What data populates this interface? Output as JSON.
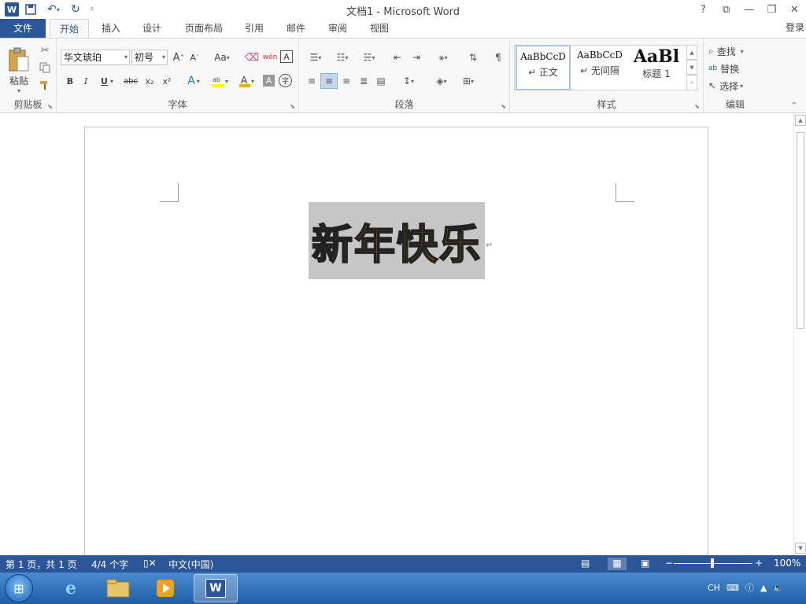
{
  "app": {
    "title": "文档1 - Microsoft Word",
    "login_label": "登录"
  },
  "window_controls": {
    "help": "?",
    "ribbon_opts": "⧉",
    "minimize": "—",
    "restore": "❐",
    "close": "✕"
  },
  "tabs": [
    {
      "label": "文件"
    },
    {
      "label": "开始"
    },
    {
      "label": "插入"
    },
    {
      "label": "设计"
    },
    {
      "label": "页面布局"
    },
    {
      "label": "引用"
    },
    {
      "label": "邮件"
    },
    {
      "label": "审阅"
    },
    {
      "label": "视图"
    }
  ],
  "ribbon": {
    "clipboard": {
      "label": "剪贴板",
      "paste": "粘贴"
    },
    "font": {
      "label": "字体",
      "font_name": "华文琥珀",
      "font_size": "初号",
      "bold": "B",
      "italic": "I",
      "underline": "U",
      "strike": "abc",
      "sub": "x₂",
      "sup": "x²",
      "case": "Aa",
      "grow": "A",
      "shrink": "A",
      "pinyin": "wén",
      "border": "A"
    },
    "paragraph": {
      "label": "段落"
    },
    "styles": {
      "label": "样式",
      "items": [
        {
          "sample": "AaBbCcD",
          "name": "↵ 正文"
        },
        {
          "sample": "AaBbCcD",
          "name": "↵ 无间隔"
        },
        {
          "sample": "AaBl",
          "name": "标题 1"
        }
      ]
    },
    "editing": {
      "label": "编辑",
      "find": "查找",
      "replace": "替换",
      "select": "选择"
    }
  },
  "document": {
    "wordart_text": "新年快乐",
    "para_mark": "↵"
  },
  "status": {
    "page": "第 1 页，共 1 页",
    "words": "4/4 个字",
    "language": "中文(中国)",
    "zoom": "100%",
    "zoom_minus": "−",
    "zoom_plus": "+"
  },
  "taskbar": {
    "tray_lang": "CH"
  }
}
